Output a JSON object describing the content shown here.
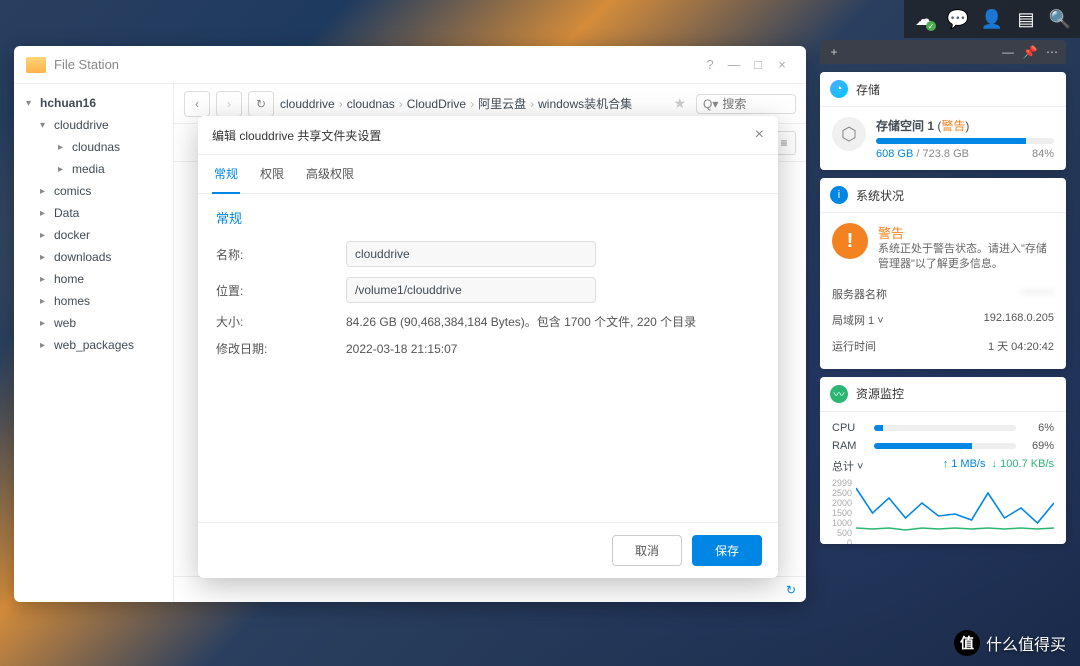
{
  "taskbar": {
    "icons": [
      "cloud-icon",
      "chat-icon",
      "user-icon",
      "dashboard-icon",
      "search-icon"
    ]
  },
  "file_station": {
    "title": "File Station",
    "window_buttons": {
      "help": "?",
      "min": "—",
      "max": "□",
      "close": "×"
    },
    "tree": {
      "root": "hchuan16",
      "nodes": [
        {
          "label": "clouddrive",
          "expanded": true,
          "children": [
            {
              "label": "cloudnas"
            },
            {
              "label": "media"
            }
          ]
        },
        {
          "label": "comics"
        },
        {
          "label": "Data"
        },
        {
          "label": "docker"
        },
        {
          "label": "downloads"
        },
        {
          "label": "home"
        },
        {
          "label": "homes"
        },
        {
          "label": "web"
        },
        {
          "label": "web_packages"
        }
      ]
    },
    "breadcrumb": [
      "clouddrive",
      "cloudnas",
      "CloudDrive",
      "阿里云盘",
      "windows装机合集"
    ],
    "search_placeholder": "搜索",
    "search_dropdown": "Q"
  },
  "modal": {
    "title": "编辑 clouddrive 共享文件夹设置",
    "tabs": [
      "常规",
      "权限",
      "高级权限"
    ],
    "active_tab": 0,
    "section": "常规",
    "fields": {
      "name_label": "名称:",
      "name_value": "clouddrive",
      "location_label": "位置:",
      "location_value": "/volume1/clouddrive",
      "size_label": "大小:",
      "size_value": "84.26 GB (90,468,384,184 Bytes)。包含 1700 个文件,   220 个目录",
      "modified_label": "修改日期:",
      "modified_value": "2022-03-18 21:15:07"
    },
    "buttons": {
      "cancel": "取消",
      "save": "保存"
    }
  },
  "widgets": {
    "storage": {
      "title": "存储",
      "volume_label": "存储空间 1",
      "status": "警告",
      "used": "608 GB",
      "total": "723.8 GB",
      "percent": "84%",
      "percent_num": 84
    },
    "system": {
      "title": "系统状况",
      "status": "警告",
      "desc": "系统正处于警告状态。请进入\"存储管理器\"以了解更多信息。",
      "rows": [
        {
          "label": "服务器名称",
          "value": "———",
          "blur": true
        },
        {
          "label": "局域网 1 ˅",
          "value": "192.168.0.205"
        },
        {
          "label": "运行时间",
          "value": "1 天 04:20:42"
        }
      ]
    },
    "resource": {
      "title": "资源监控",
      "cpu_label": "CPU",
      "cpu_pct": 6,
      "cpu_text": "6%",
      "ram_label": "RAM",
      "ram_pct": 69,
      "ram_text": "69%",
      "total_label": "总计 ˅",
      "up": "↑ 1 MB/s",
      "down": "↓ 100.7 KB/s",
      "ylabels": [
        "2999",
        "2500",
        "2000",
        "1500",
        "1000",
        "500",
        "0"
      ]
    }
  },
  "watermark": "什么值得买"
}
